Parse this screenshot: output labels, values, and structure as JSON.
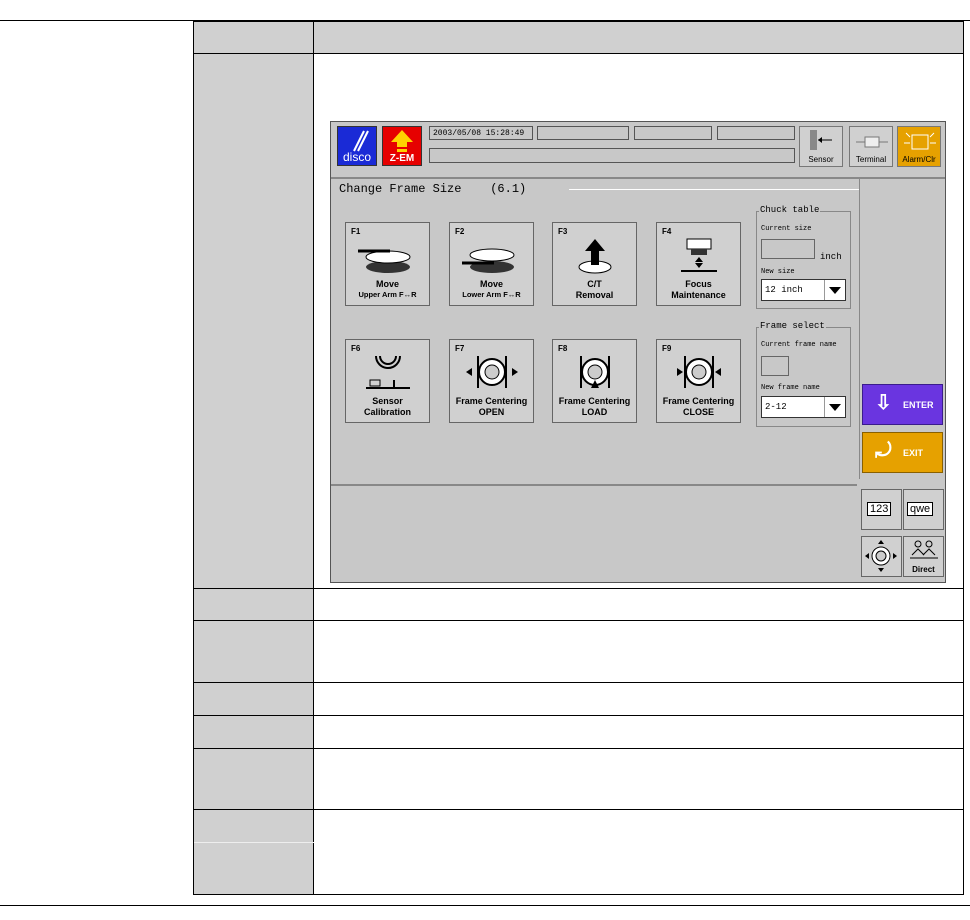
{
  "screen": {
    "datetime": "2003/05/08 15:28:49",
    "logos": {
      "disco": "disco",
      "zem": "Z-EM"
    },
    "toolbar": {
      "sensor": "Sensor",
      "terminal": "Terminal",
      "alarm": "Alarm/Clr"
    },
    "title": "Change Frame Size",
    "title_ref": "(6.1)",
    "function_buttons": [
      {
        "key": "F1",
        "line1": "Move",
        "line2": "Upper Arm F↔R"
      },
      {
        "key": "F2",
        "line1": "Move",
        "line2": "Lower Arm F↔R"
      },
      {
        "key": "F3",
        "line1": "C/T",
        "line2": "Removal"
      },
      {
        "key": "F4",
        "line1": "Focus",
        "line2": "Maintenance"
      },
      {
        "key": "F6",
        "line1": "Sensor",
        "line2": "Calibration"
      },
      {
        "key": "F7",
        "line1": "Frame Centering",
        "line2": "OPEN"
      },
      {
        "key": "F8",
        "line1": "Frame Centering",
        "line2": "LOAD"
      },
      {
        "key": "F9",
        "line1": "Frame Centering",
        "line2": "CLOSE"
      }
    ],
    "chuck_table": {
      "title": "Chuck table",
      "current_label": "Current size",
      "unit": "inch",
      "new_label": "New size",
      "new_value": "12 inch"
    },
    "frame_select": {
      "title": "Frame select",
      "current_label": "Current frame name",
      "new_label": "New frame name",
      "new_value": "2-12"
    },
    "enter_label": "ENTER",
    "exit_label": "EXIT",
    "small_buttons": {
      "numeric": "123",
      "alpha": "qwe",
      "direct": "Direct"
    },
    "colors": {
      "bg": "#c8c8c8",
      "enter": "#6a35e0",
      "exit": "#e6a100",
      "disco": "#1a2ad6",
      "zem": "#e60000"
    }
  }
}
